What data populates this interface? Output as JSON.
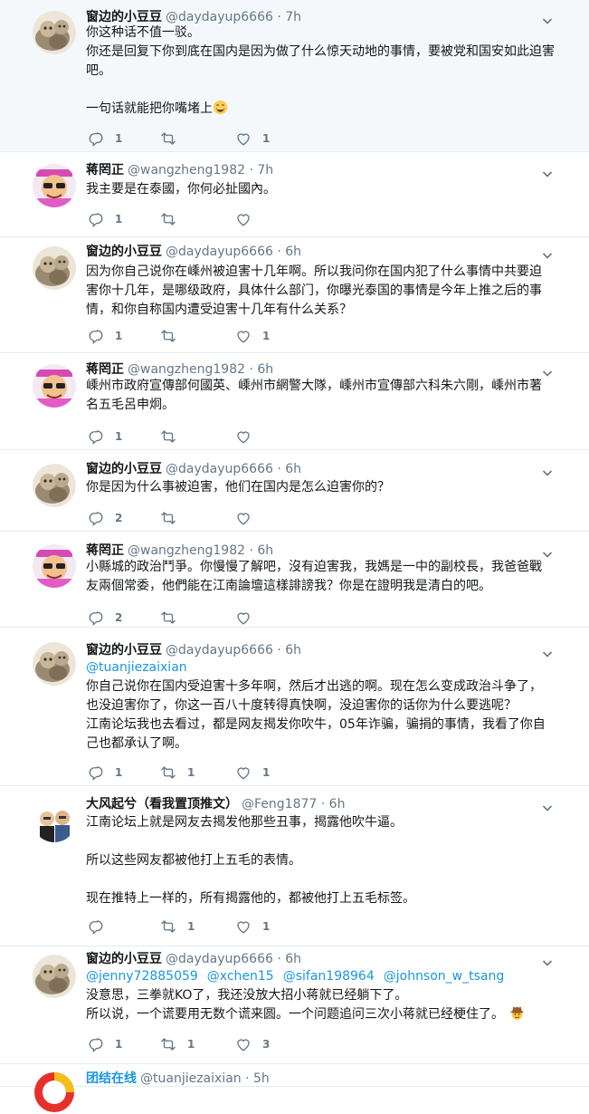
{
  "tweets": [
    {
      "name": "窗边的小豆豆",
      "handle": "@daydayup6666",
      "time": "7h",
      "lines": [
        "你这种话不值一驳。",
        "你还是回复下你到底在国内是因为做了什么惊天动地的事情，要被党和国安如此迫害吧。",
        "",
        "一句话就能把你嘴堵上"
      ],
      "reply_count": "1",
      "retweet_count": "",
      "like_count": "1"
    },
    {
      "name": "蒋罔正",
      "handle": "@wangzheng1982",
      "time": "7h",
      "lines": [
        "我主要是在泰國，你何必扯國內。"
      ],
      "reply_count": "1",
      "retweet_count": "",
      "like_count": ""
    },
    {
      "name": "窗边的小豆豆",
      "handle": "@daydayup6666",
      "time": "6h",
      "lines": [
        "因为你自己说你在嵊州被迫害十几年啊。所以我问你在国内犯了什么事情中共要迫",
        "害你十几年，是哪级政府，具体什么部门，你曝光泰国的事情是今年上推之后的事",
        "情，和你自称国内遭受迫害十几年有什么关系？"
      ],
      "reply_count": "1",
      "retweet_count": "",
      "like_count": "1"
    },
    {
      "name": "蒋罔正",
      "handle": "@wangzheng1982",
      "time": "6h",
      "lines": [
        "嵊州市政府宣傳部何國英、嵊州市網警大隊，嵊州市宣傳部六科朱六剛，嵊州市著",
        "名五毛呂申炯。"
      ],
      "reply_count": "1",
      "retweet_count": "",
      "like_count": ""
    },
    {
      "name": "窗边的小豆豆",
      "handle": "@daydayup6666",
      "time": "6h",
      "lines": [
        "你是因为什么事被迫害，他们在国内是怎么迫害你的？"
      ],
      "reply_count": "2",
      "retweet_count": "",
      "like_count": ""
    },
    {
      "name": "蒋罔正",
      "handle": "@wangzheng1982",
      "time": "6h",
      "lines": [
        "小縣城的政治鬥爭。你慢慢了解吧，沒有迫害我，我媽是一中的副校長，我爸爸戰",
        "友兩個常委，他們能在江南論壇這樣誹謗我？你是在證明我是清白的吧。"
      ],
      "reply_count": "2",
      "retweet_count": "",
      "like_count": ""
    },
    {
      "name": "窗边的小豆豆",
      "handle": "@daydayup6666",
      "time": "6h",
      "mentions": [
        "@tuanjiezaixian"
      ],
      "lines": [
        "你自己说你在国内受迫害十多年啊，然后才出逃的啊。现在怎么变成政治斗争了，",
        "也没迫害你了，你这一百八十度转得真快啊，没迫害你的话你为什么要逃呢？",
        "江南论坛我也去看过，都是网友揭发你吹牛，05年诈骗，骗捐的事情，我看了你自",
        "己也都承认了啊。"
      ],
      "reply_count": "1",
      "retweet_count": "1",
      "like_count": "1"
    },
    {
      "name": "大风起兮（看我置顶推文）",
      "handle": "@Feng1877",
      "time": "6h",
      "lines": [
        "江南论坛上就是网友去揭发他那些丑事，揭露他吹牛逼。",
        "",
        "所以这些网友都被他打上五毛的表情。",
        "",
        "现在推特上一样的，所有揭露他的，都被他打上五毛标签。"
      ],
      "reply_count": "",
      "retweet_count": "1",
      "like_count": "1"
    },
    {
      "name": "窗边的小豆豆",
      "handle": "@daydayup6666",
      "time": "6h",
      "mentions": [
        "@jenny72885059",
        "@xchen15",
        "@sifan198964",
        "@johnson_w_tsang"
      ],
      "lines": [
        "没意思，三拳就KO了，我还没放大招小蒋就已经躺下了。",
        "所以说，一个谎要用无数个谎来圆。一个问题追问三次小蒋就已经梗住了。"
      ],
      "reply_count": "1",
      "retweet_count": "1",
      "like_count": "3"
    },
    {
      "name": "团结在线",
      "handle": "@tuanjiezaixian",
      "time": "5h",
      "lines": [],
      "reply_count": "",
      "retweet_count": "",
      "like_count": ""
    }
  ],
  "colors": {
    "name_link": "#1b95e0",
    "muted": "#657786",
    "highlight_bg": "#f5f8fa"
  },
  "icons": [
    "reply-icon",
    "retweet-icon",
    "like-icon",
    "chevron-down-icon",
    "grinning-emoji-icon",
    "cowboy-emoji-icon"
  ]
}
